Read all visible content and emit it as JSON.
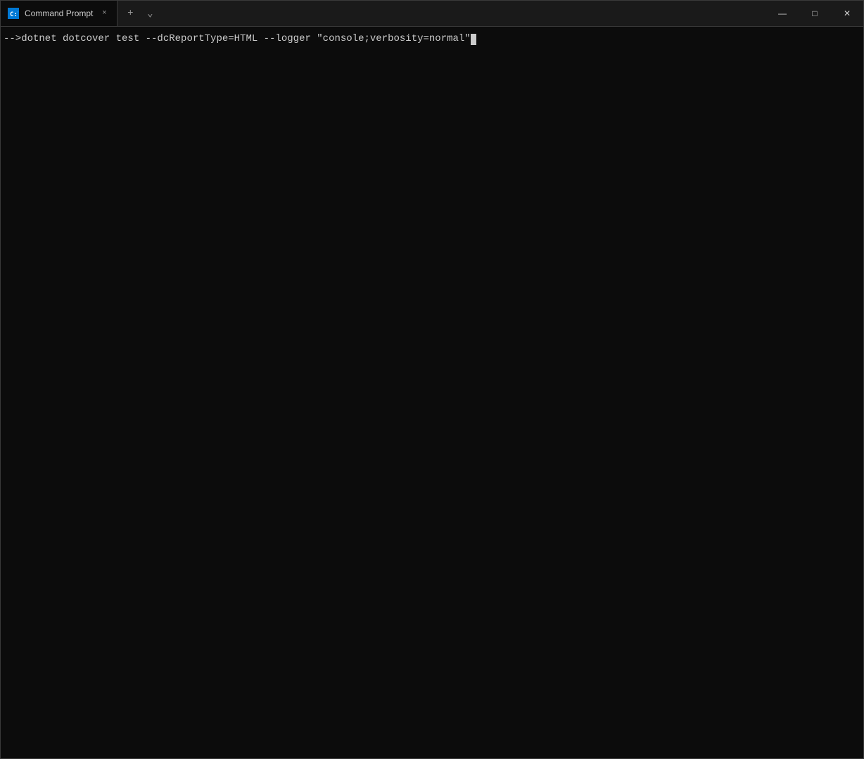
{
  "window": {
    "title": "Command Prompt",
    "background_color": "#0c0c0c",
    "border_color": "#3a3a3a"
  },
  "titlebar": {
    "tab_label": "Command Prompt",
    "tab_close_symbol": "×",
    "add_tab_symbol": "+",
    "dropdown_symbol": "⌄",
    "minimize_symbol": "—",
    "maximize_symbol": "□",
    "close_symbol": "✕"
  },
  "terminal": {
    "command_line": "-->dotnet dotcover test --dcReportType=HTML --logger \"console;verbosity=normal\""
  }
}
